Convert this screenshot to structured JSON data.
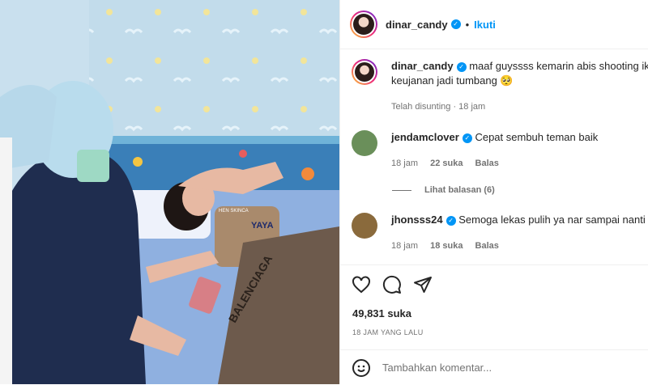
{
  "post": {
    "username": "dinar_candy",
    "follow_label": "Ikuti",
    "caption": {
      "username": "dinar_candy",
      "text_line1": "maaf guyssss kemarin abis shooting ik",
      "text_line2": "keujanan jadi tumbang 🥺",
      "meta": "Telah disunting · 18 jam"
    },
    "comments": [
      {
        "username": "jendamclover",
        "text": "Cepat sembuh teman baik",
        "time": "18 jam",
        "likes": "22 suka",
        "reply": "Balas"
      },
      {
        "username": "jhonsss24",
        "text": "Semoga lekas pulih ya nar sampai nanti",
        "time": "18 jam",
        "likes": "18 suka",
        "reply": "Balas"
      }
    ],
    "view_replies": "Lihat balasan (6)",
    "like_count": "49,831 suka",
    "timestamp": "18 JAM YANG LALU",
    "add_comment_placeholder": "Tambahkan komentar..."
  },
  "photo": {
    "shirt_text": "YAYA",
    "shirt_small": "HEN SKINCA",
    "pants_text": "BALENCIAGA"
  }
}
